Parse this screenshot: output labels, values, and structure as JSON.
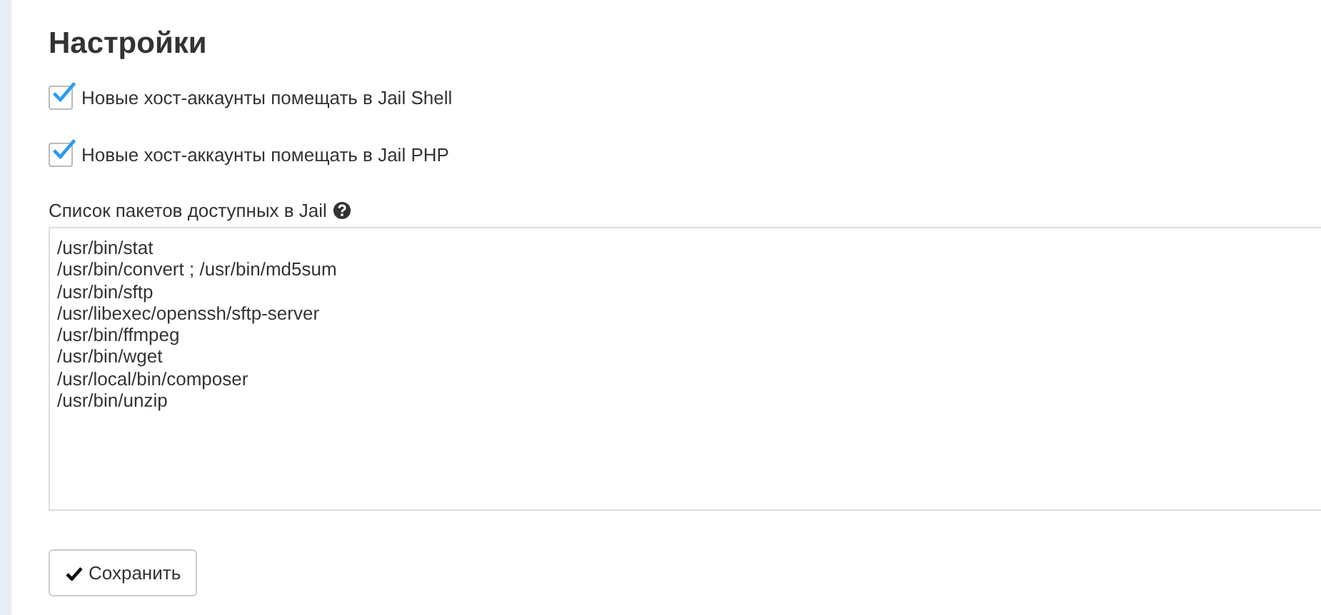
{
  "title": "Настройки",
  "options": [
    {
      "label": "Новые хост-аккаунты помещать в Jail Shell",
      "checked": true
    },
    {
      "label": "Новые хост-аккаунты помещать в Jail PHP",
      "checked": true
    }
  ],
  "packages": {
    "label": "Список пакетов доступных в Jail",
    "lines": [
      "/usr/bin/stat",
      "/usr/bin/convert ; /usr/bin/md5sum",
      "/usr/bin/sftp",
      "/usr/libexec/openssh/sftp-server",
      "/usr/bin/ffmpeg",
      "/usr/bin/wget",
      "/usr/local/bin/composer",
      "/usr/bin/unzip"
    ]
  },
  "save_button": "Сохранить"
}
